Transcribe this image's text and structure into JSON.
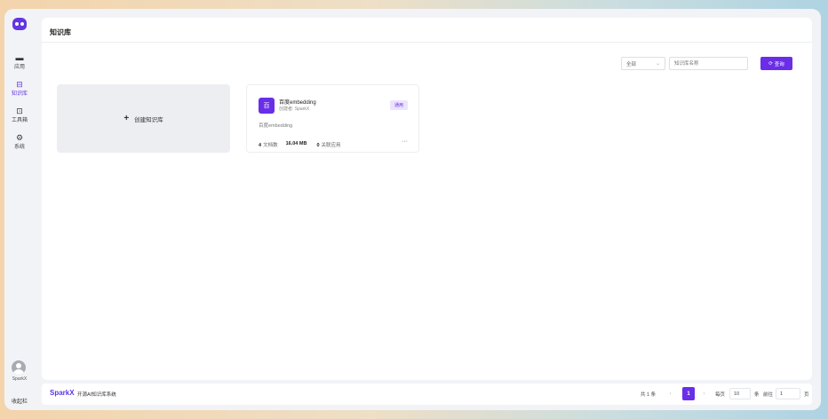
{
  "sidebar": {
    "items": [
      {
        "label": "应用",
        "icon": "app-icon"
      },
      {
        "label": "知识库",
        "icon": "database-icon",
        "active": true
      },
      {
        "label": "工具箱",
        "icon": "toolbox-icon"
      },
      {
        "label": "系统",
        "icon": "gear-icon"
      }
    ],
    "user_name": "SparkX",
    "collapse_label": "收起栏"
  },
  "page": {
    "title": "知识库"
  },
  "filters": {
    "scope_value": "全部",
    "search_placeholder": "知识库名称",
    "query_label": "查询"
  },
  "create_card": {
    "label": "创建知识库"
  },
  "knowledge_bases": [
    {
      "icon_text": "百",
      "name": "百度embedding",
      "creator": "创建者: SparkX",
      "tag": "通用",
      "description": "百度embedding",
      "doc_count": "4",
      "doc_label": "文档数",
      "size": "16.04 MB",
      "app_count": "0",
      "app_label": "关联应用",
      "more": "···"
    }
  ],
  "footer": {
    "brand": "SparkX",
    "tagline": "开源AI知识库系统"
  },
  "pagination": {
    "total": "共 1 条",
    "prev": "‹",
    "current_page": "1",
    "next": "›",
    "per_page_label": "每页",
    "page_size": "10",
    "unit": "条",
    "goto_label": "前往",
    "goto_value": "1",
    "page_suffix": "页"
  },
  "colors": {
    "accent": "#6a2ee8",
    "tag_bg": "#ece4fd"
  }
}
